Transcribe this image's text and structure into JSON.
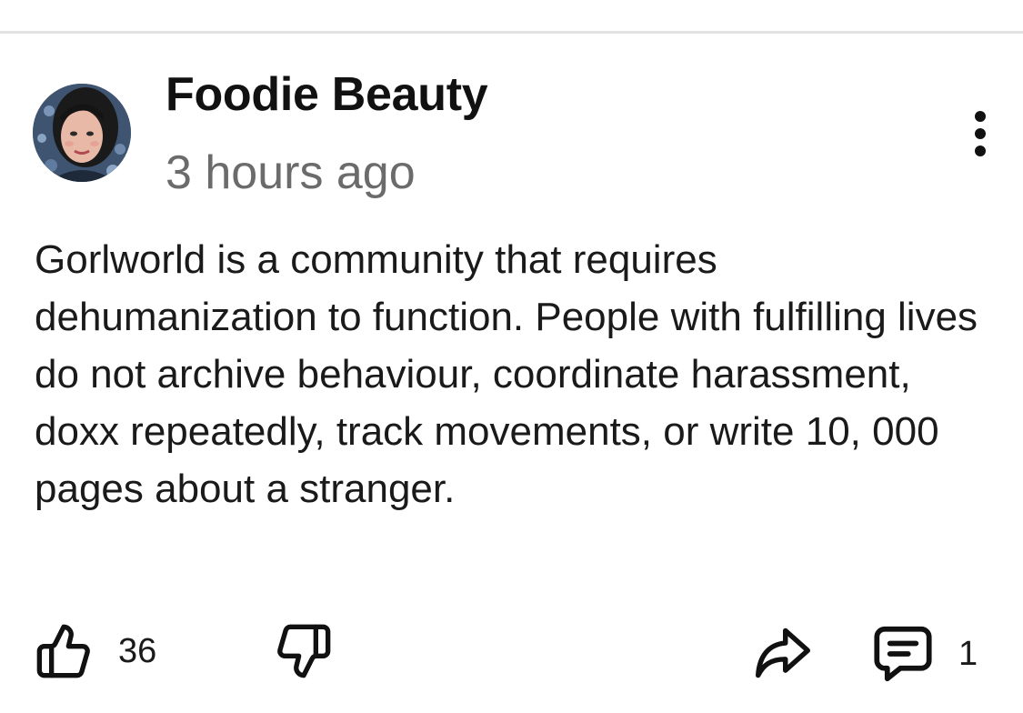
{
  "post": {
    "author": "Foodie Beauty",
    "timestamp": "3 hours ago",
    "body": "Gorlworld is a community that requires dehumanization to function. People with fulfilling lives do not archive behaviour, coordinate harassment, doxx repeatedly, track movements, or write 10, 000 pages about a stranger."
  },
  "actions": {
    "upvote_icon": "thumbs-up-icon",
    "upvote_count": "36",
    "downvote_icon": "thumbs-down-icon",
    "share_icon": "share-arrow-icon",
    "comment_icon": "comment-bubble-icon",
    "comment_count": "1"
  },
  "menu_icon": "vertical-ellipsis-icon",
  "colors": {
    "text_primary": "#111111",
    "text_secondary": "#6b6b6b",
    "divider": "#e3e3e3",
    "background": "#ffffff"
  }
}
